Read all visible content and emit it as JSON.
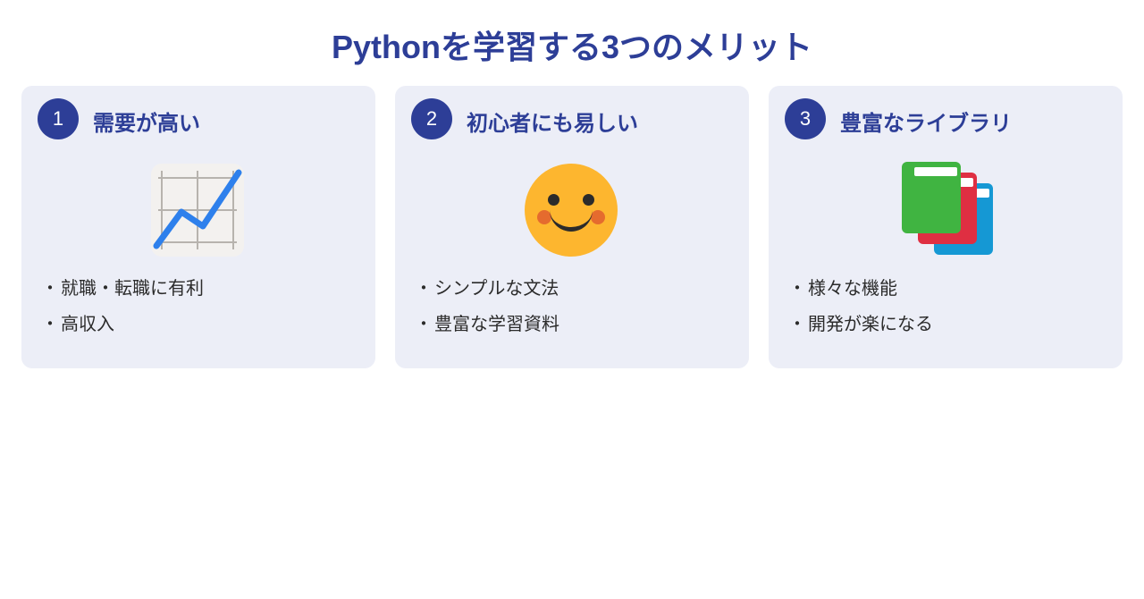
{
  "title": "Pythonを学習する3つのメリット",
  "colors": {
    "accent": "#2d3e97",
    "card_bg": "#eceef7"
  },
  "cards": [
    {
      "number": "1",
      "title": "需要が高い",
      "icon_name": "chart-up-icon",
      "bullets": [
        "就職・転職に有利",
        "高収入"
      ]
    },
    {
      "number": "2",
      "title": "初心者にも易しい",
      "icon_name": "smiling-face-icon",
      "bullets": [
        "シンプルな文法",
        "豊富な学習資料"
      ]
    },
    {
      "number": "3",
      "title": "豊富なライブラリ",
      "icon_name": "books-icon",
      "bullets": [
        "様々な機能",
        "開発が楽になる"
      ]
    }
  ]
}
